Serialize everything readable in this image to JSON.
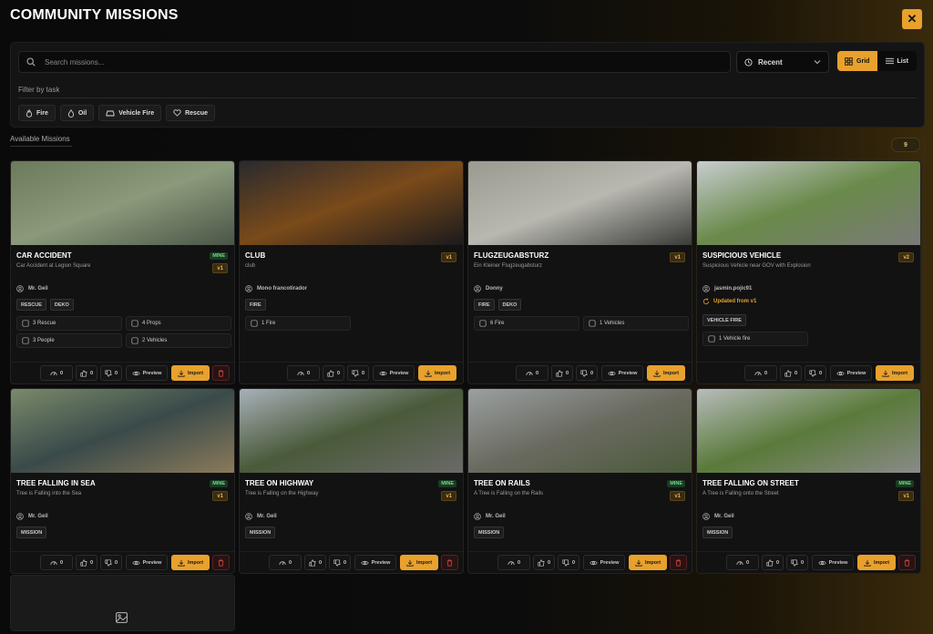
{
  "header": {
    "title": "COMMUNITY MISSIONS",
    "close_icon": "close-icon"
  },
  "search": {
    "placeholder": "Search missions...",
    "value": ""
  },
  "sort": {
    "selected": "Recent"
  },
  "view": {
    "grid_label": "Grid",
    "list_label": "List",
    "active": "grid"
  },
  "filter": {
    "label": "Filter by task",
    "chips": [
      {
        "label": "Fire",
        "icon": "flame-icon"
      },
      {
        "label": "Oil",
        "icon": "droplet-icon"
      },
      {
        "label": "Vehicle Fire",
        "icon": "car-icon"
      },
      {
        "label": "Rescue",
        "icon": "heart-icon"
      }
    ]
  },
  "section": {
    "label": "Available Missions",
    "count": "9"
  },
  "actions": {
    "preview_label": "Preview",
    "import_label": "Import"
  },
  "missions": [
    {
      "title": "CAR ACCIDENT",
      "subtitle": "Car Accident at Legion Square",
      "mine": "MINE",
      "version": "v1",
      "author": "Mr. Geil",
      "updated": "",
      "tags": [
        "RESCUE",
        "DEKO"
      ],
      "stats": [
        "3 Rescue",
        "4 Props",
        "3 People",
        "2 Vehicles"
      ],
      "views": "0",
      "likes": "0",
      "dislikes": "0",
      "thumb": [
        "#6a7a5a",
        "#8b9a7a",
        "#4a5548"
      ]
    },
    {
      "title": "CLUB",
      "subtitle": "club",
      "mine": "",
      "version": "v1",
      "author": "Mono francotirador",
      "updated": "",
      "tags": [
        "FIRE"
      ],
      "stats": [
        "1 Fire"
      ],
      "views": "0",
      "likes": "0",
      "dislikes": "0",
      "thumb": [
        "#2a2a2e",
        "#7a4a1a",
        "#1a1a1c"
      ]
    },
    {
      "title": "FLUGZEUGABSTURZ",
      "subtitle": "Ein Kleiner Flugzeugabsturz",
      "mine": "",
      "version": "v1",
      "author": "Donny",
      "updated": "",
      "tags": [
        "FIRE",
        "DEKO"
      ],
      "stats": [
        "6 Fire",
        "1 Vehicles"
      ],
      "views": "0",
      "likes": "0",
      "dislikes": "0",
      "thumb": [
        "#9a9a90",
        "#b8b8b0",
        "#3a3a38"
      ]
    },
    {
      "title": "SUSPICIOUS VEHICLE",
      "subtitle": "Suspicious Vehicle near GOV with Explosion",
      "mine": "",
      "version": "v2",
      "author": "jasmin.pojic91",
      "updated": "Updated from v1",
      "tags": [
        "VEHICLE FIRE"
      ],
      "stats": [
        "1 Vehicle fire"
      ],
      "views": "0",
      "likes": "0",
      "dislikes": "0",
      "thumb": [
        "#c8ccd0",
        "#6a8a4a",
        "#7a7a78"
      ]
    },
    {
      "title": "TREE FALLING IN SEA",
      "subtitle": "Tree is Falling into the Sea",
      "mine": "MINE",
      "version": "v1",
      "author": "Mr. Geil",
      "updated": "",
      "tags": [
        "MISSION"
      ],
      "stats": [],
      "views": "0",
      "likes": "0",
      "dislikes": "0",
      "thumb": [
        "#7a8a6a",
        "#3a4a4a",
        "#8a7a5a"
      ]
    },
    {
      "title": "TREE ON HIGHWAY",
      "subtitle": "Tree is Falling on the Highway",
      "mine": "MINE",
      "version": "v1",
      "author": "Mr. Geil",
      "updated": "",
      "tags": [
        "MISSION"
      ],
      "stats": [],
      "views": "0",
      "likes": "0",
      "dislikes": "0",
      "thumb": [
        "#a8b0b8",
        "#4a5a3a",
        "#6a6a68"
      ]
    },
    {
      "title": "TREE ON RAILS",
      "subtitle": "A Tree is Falling on the Rails",
      "mine": "MINE",
      "version": "v1",
      "author": "Mr. Geil",
      "updated": "",
      "tags": [
        "MISSION"
      ],
      "stats": [],
      "views": "0",
      "likes": "0",
      "dislikes": "0",
      "thumb": [
        "#9aa0a0",
        "#6a6a60",
        "#4a5a3a"
      ]
    },
    {
      "title": "TREE FALLING ON STREET",
      "subtitle": "A Tree is Falling onto the Street",
      "mine": "MINE",
      "version": "v1",
      "author": "Mr. Geil",
      "updated": "",
      "tags": [
        "MISSION"
      ],
      "stats": [],
      "views": "0",
      "likes": "0",
      "dislikes": "0",
      "thumb": [
        "#b8bcbc",
        "#5a7a3a",
        "#8a8a88"
      ]
    }
  ]
}
